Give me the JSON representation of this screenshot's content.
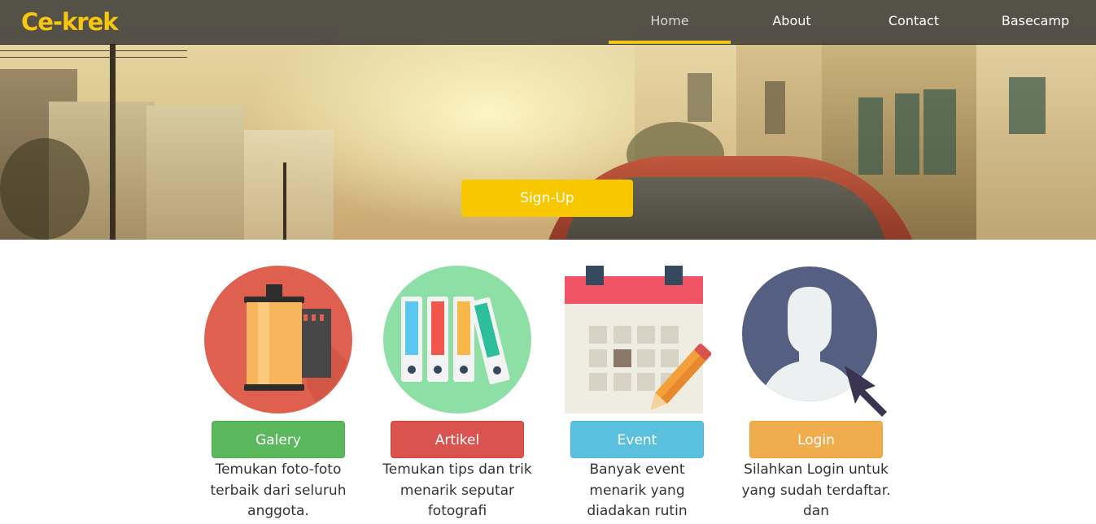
{
  "navbar": {
    "brand": "Ce-krek",
    "items": [
      "Home",
      "About",
      "Contact",
      "Basecamp"
    ],
    "active": "Home",
    "accent_color": "#f3c60f"
  },
  "hero": {
    "signup_label": "Sign-Up"
  },
  "features": [
    {
      "icon": "film-roll-icon",
      "button": "Galery",
      "description": "Temukan foto-foto terbaik dari seluruh anggota.",
      "color": "#5cb85c"
    },
    {
      "icon": "binders-icon",
      "button": "Artikel",
      "description": "Temukan tips dan trik menarik seputar fotografi",
      "color": "#d9534f"
    },
    {
      "icon": "calendar-icon",
      "button": "Event",
      "description": "Banyak event menarik yang diadakan rutin",
      "color": "#5bc0de"
    },
    {
      "icon": "user-login-icon",
      "button": "Login",
      "description": "Silahkan Login untuk yang sudah terdaftar. dan",
      "color": "#f0ad4e"
    }
  ]
}
